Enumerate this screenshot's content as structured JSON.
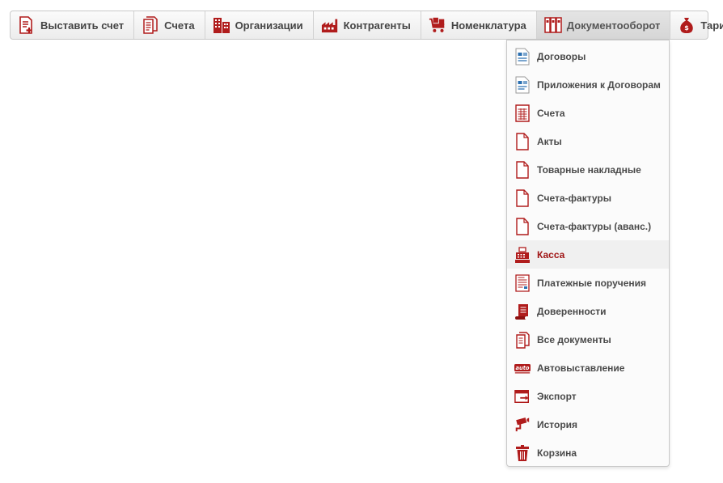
{
  "colors": {
    "accent": "#b01c1c",
    "text": "#444444",
    "hover_text": "#a01515"
  },
  "menubar": {
    "items": [
      {
        "label": "Выставить счет",
        "icon": "invoice-add-icon"
      },
      {
        "label": "Счета",
        "icon": "documents-icon"
      },
      {
        "label": "Организации",
        "icon": "buildings-icon"
      },
      {
        "label": "Контрагенты",
        "icon": "factory-icon"
      },
      {
        "label": "Номенклатура",
        "icon": "cart-icon"
      },
      {
        "label": "Документооборот",
        "icon": "binders-icon",
        "active": true
      },
      {
        "label": "Тарифы",
        "icon": "money-bag-icon"
      }
    ]
  },
  "dropdown": {
    "items": [
      {
        "label": "Договоры",
        "icon": "contract-icon"
      },
      {
        "label": "Приложения к Договорам",
        "icon": "contract-attachment-icon"
      },
      {
        "label": "Счета",
        "icon": "invoice-table-icon"
      },
      {
        "label": "Акты",
        "icon": "blank-page-icon"
      },
      {
        "label": "Товарные накладные",
        "icon": "blank-page-icon"
      },
      {
        "label": "Счета-фактуры",
        "icon": "blank-page-icon"
      },
      {
        "label": "Счета-фактуры (аванс.)",
        "icon": "blank-page-icon"
      },
      {
        "label": "Касса",
        "icon": "cash-register-icon",
        "hover": true
      },
      {
        "label": "Платежные поручения",
        "icon": "payment-order-icon"
      },
      {
        "label": "Доверенности",
        "icon": "scroll-icon"
      },
      {
        "label": "Все документы",
        "icon": "all-documents-icon"
      },
      {
        "label": "Автовыставление",
        "icon": "auto-icon",
        "badge": "auto"
      },
      {
        "label": "Экспорт",
        "icon": "export-icon"
      },
      {
        "label": "История",
        "icon": "history-camera-icon"
      },
      {
        "label": "Корзина",
        "icon": "trash-icon"
      }
    ]
  }
}
